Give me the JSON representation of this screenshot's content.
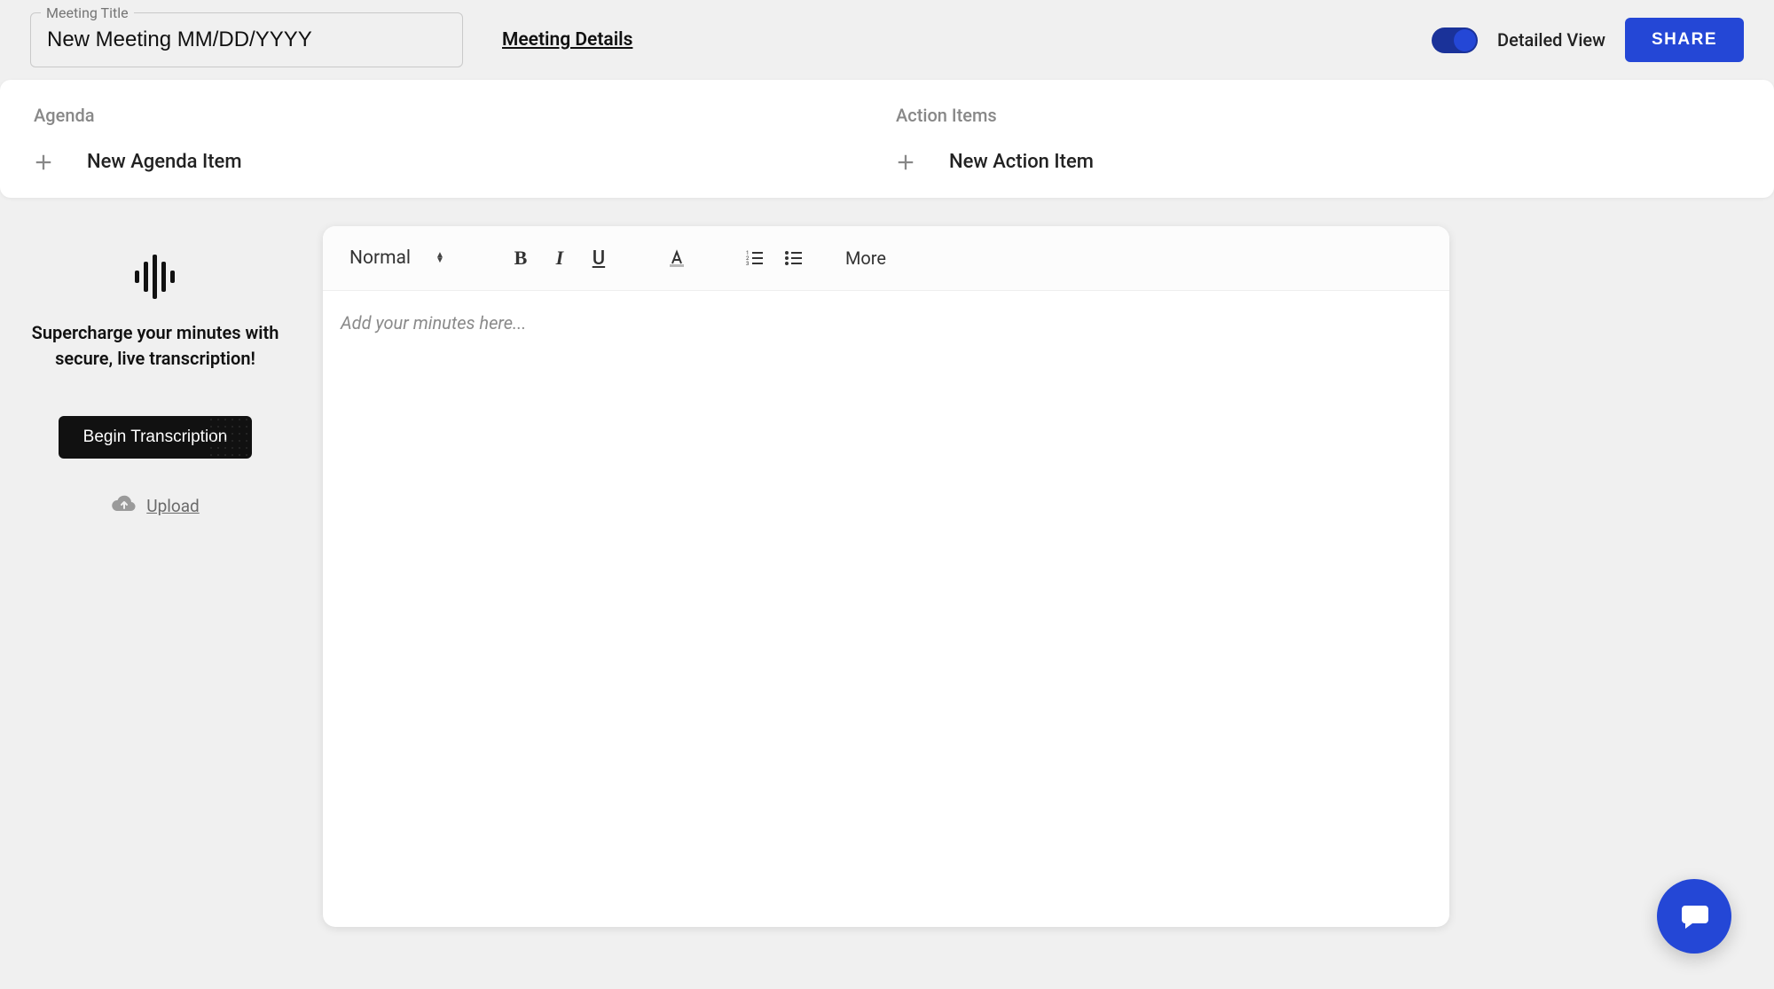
{
  "header": {
    "title_label": "Meeting Title",
    "title_value": "New Meeting MM/DD/YYYY",
    "details_link": "Meeting Details",
    "toggle_label": "Detailed View",
    "share_label": "SHARE"
  },
  "panels": {
    "agenda_heading": "Agenda",
    "agenda_add": "New Agenda Item",
    "action_heading": "Action Items",
    "action_add": "New Action Item"
  },
  "transcribe": {
    "promo_line1": "Supercharge your minutes with",
    "promo_line2": "secure, live transcription!",
    "begin_label": "Begin Transcription",
    "upload_label": "Upload"
  },
  "editor": {
    "style_label": "Normal",
    "more_label": "More",
    "placeholder": "Add your minutes here..."
  }
}
